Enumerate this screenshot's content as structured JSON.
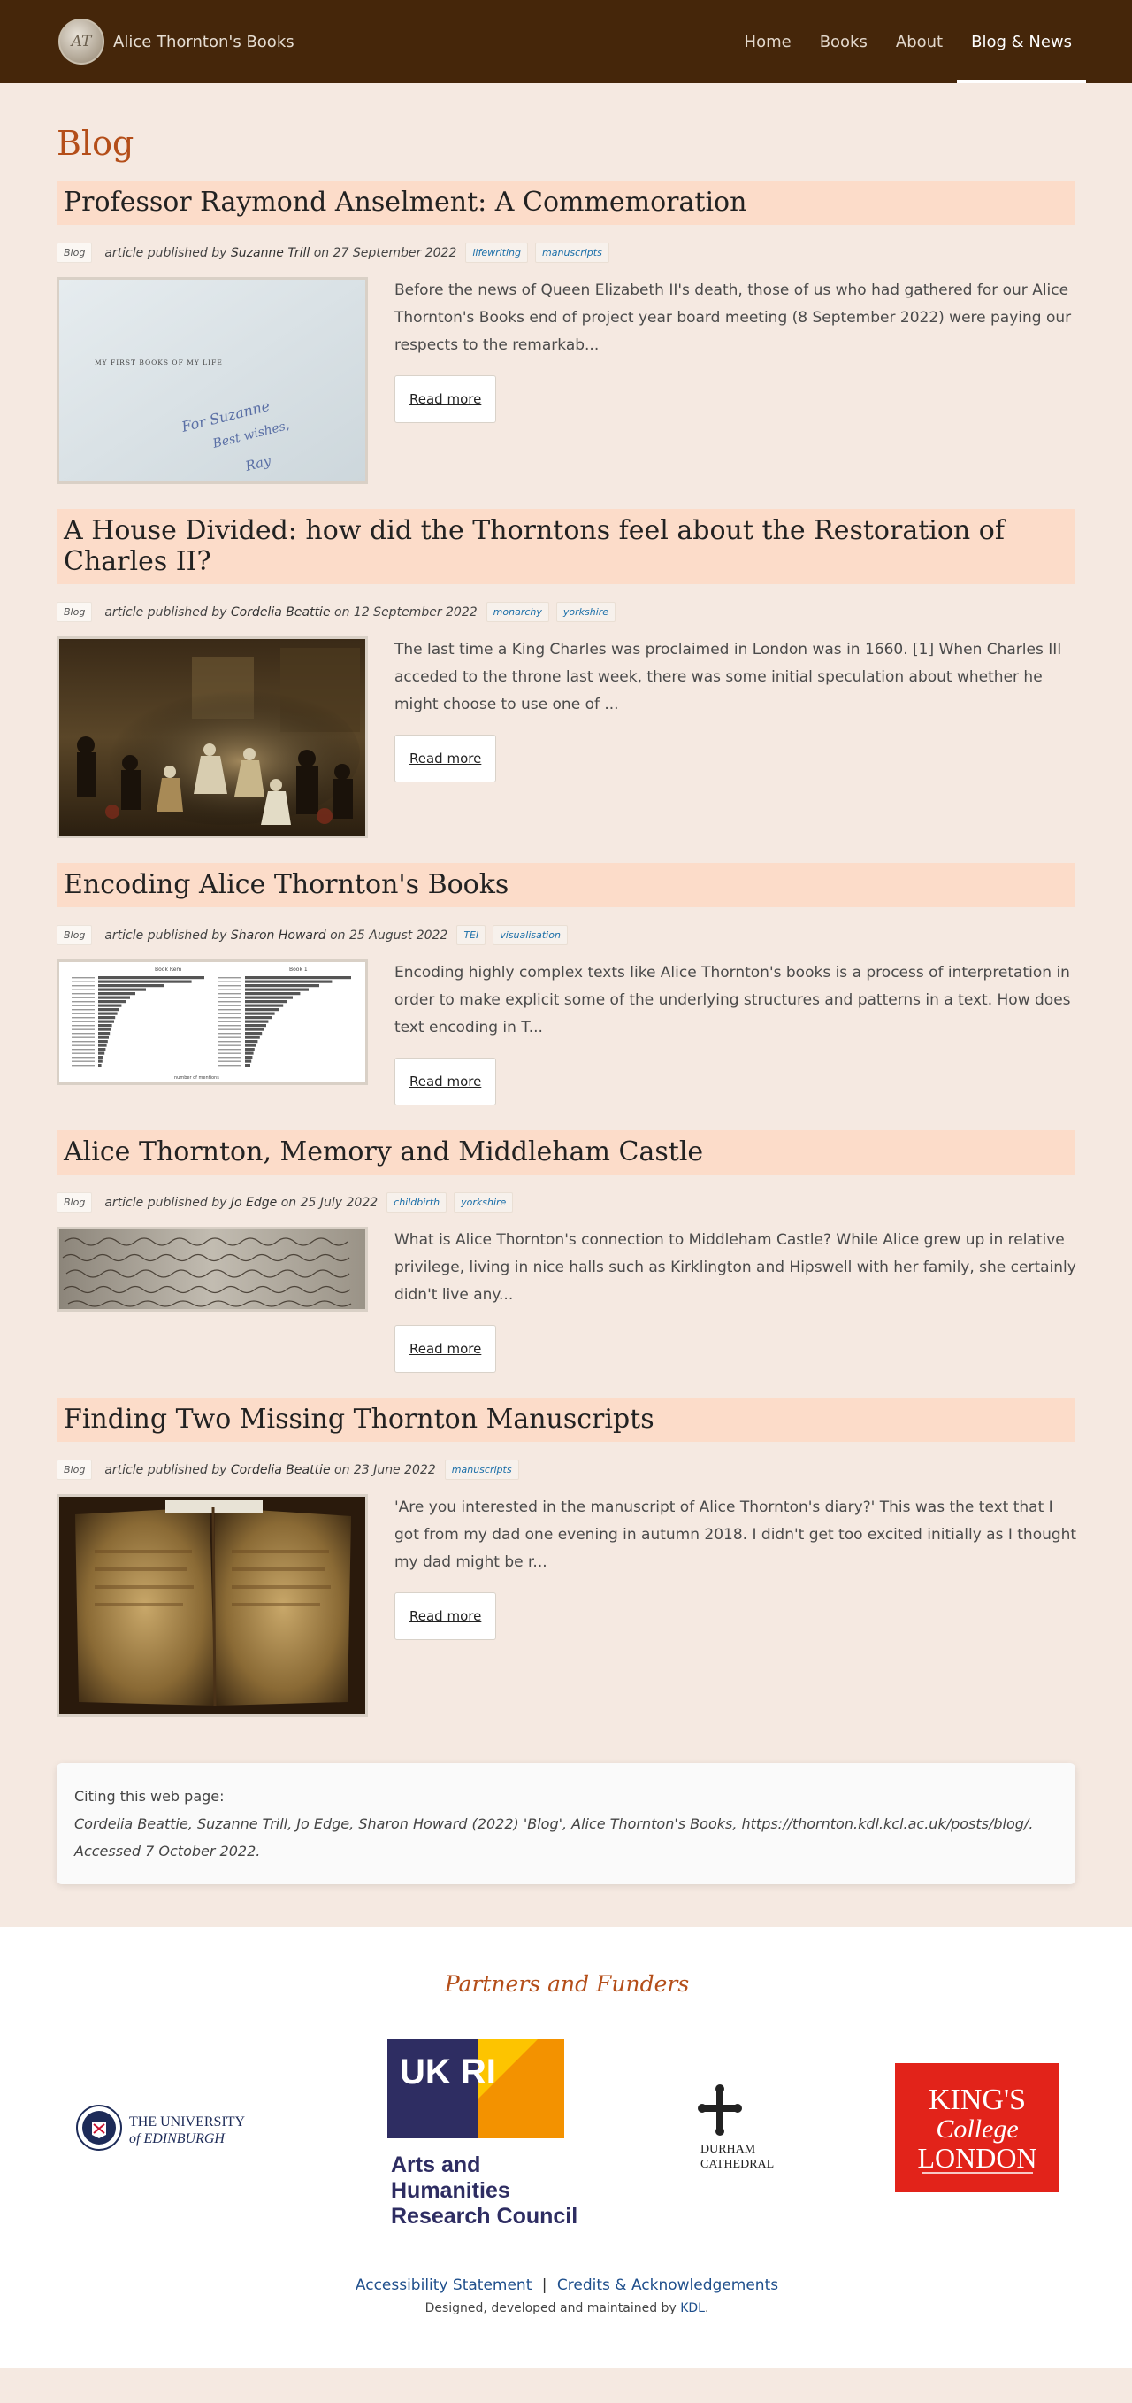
{
  "header": {
    "logo_text": "AT",
    "site_name": "Alice Thornton's Books",
    "nav": [
      {
        "label": "Home"
      },
      {
        "label": "Books"
      },
      {
        "label": "About"
      },
      {
        "label": "Blog & News"
      }
    ]
  },
  "page_title": "Blog",
  "posts": [
    {
      "title": "Professor Raymond Anselment: A Commemoration",
      "category": "Blog",
      "author": "Suzanne Trill",
      "date": "27 September 2022",
      "tags": [
        "lifewriting",
        "manuscripts"
      ],
      "excerpt": "Before the news of Queen Elizabeth II's death, those of us who had gathered for our Alice Thornton's Books end of project year board meeting (8 September 2022) were paying our respects to the remarkab...",
      "read_more": "Read more",
      "thumb_text": "MY FIRST BOOKS OF MY LIFE",
      "thumb_inscription": [
        "For Suzanne",
        "Best wishes,",
        "Ray"
      ]
    },
    {
      "title": "A House Divided: how did the Thorntons feel about the Restoration of Charles II?",
      "category": "Blog",
      "author": "Cordelia Beattie",
      "date": "12 September 2022",
      "tags": [
        "monarchy",
        "yorkshire"
      ],
      "excerpt": "The last time a King Charles was proclaimed in London was in 1660. [1] When Charles III acceded to the throne last week, there was some initial speculation about whether he might choose to use one of ...",
      "read_more": "Read more"
    },
    {
      "title": "Encoding Alice Thornton's Books",
      "category": "Blog",
      "author": "Sharon Howard",
      "date": "25 August 2022",
      "tags": [
        "TEI",
        "visualisation"
      ],
      "excerpt": "Encoding highly complex texts like Alice Thornton's books is a process of interpretation in order to make explicit some of the underlying structures and patterns in a text. How does text encoding in T...",
      "read_more": "Read more",
      "thumb_panels": [
        "Book Rem",
        "Book 1"
      ],
      "thumb_axis": "number of mentions"
    },
    {
      "title": "Alice Thornton, Memory and Middleham Castle",
      "category": "Blog",
      "author": "Jo Edge",
      "date": "25 July 2022",
      "tags": [
        "childbirth",
        "yorkshire"
      ],
      "excerpt": "What is Alice Thornton's connection to Middleham Castle? While Alice grew up in relative privilege, living in nice halls such as Kirklington and Hipswell with her family, she certainly didn't live any...",
      "read_more": "Read more"
    },
    {
      "title": "Finding Two Missing Thornton Manuscripts",
      "category": "Blog",
      "author": "Cordelia Beattie",
      "date": "23 June 2022",
      "tags": [
        "manuscripts"
      ],
      "excerpt": "'Are you interested in the manuscript of Alice Thornton's diary?' This was the text that I got from my dad one evening in autumn 2018. I didn't get too excited initially as I thought my dad might be r...",
      "read_more": "Read more"
    }
  ],
  "meta_labels": {
    "published_by": "article published by",
    "on": "on"
  },
  "citation": {
    "label": "Citing this web page:",
    "text": "Cordelia Beattie, Suzanne Trill, Jo Edge, Sharon Howard (2022) 'Blog', Alice Thornton's Books, https://thornton.kdl.kcl.ac.uk/posts/blog/. Accessed 7 October 2022."
  },
  "footer": {
    "partners_title": "Partners and Funders",
    "partners": [
      {
        "name": "The University of Edinburgh",
        "line1": "THE UNIVERSITY",
        "line2": "of EDINBURGH"
      },
      {
        "name": "UKRI Arts and Humanities Research Council",
        "mark": "UK RI",
        "line1": "Arts and",
        "line2": "Humanities",
        "line3": "Research Council"
      },
      {
        "name": "Durham Cathedral",
        "line1": "DURHAM",
        "line2": "CATHEDRAL"
      },
      {
        "name": "King's College London",
        "line1": "KING'S",
        "line2": "College",
        "line3": "LONDON"
      }
    ],
    "accessibility_link": "Accessibility Statement",
    "separator": "|",
    "credits_link": "Credits & Acknowledgements",
    "credit_prefix": "Designed, developed and maintained by",
    "credit_link": "KDL",
    "credit_suffix": "."
  },
  "colors": {
    "header_bg": "#45260a",
    "page_bg": "#f5e9e1",
    "title_accent": "#b44e19",
    "post_title_bg": "#fcdcc9",
    "link_blue": "#1f4f8c",
    "kcl_red": "#e2231a",
    "ukri_navy": "#2e2d62",
    "ukri_orange": "#f39200"
  }
}
